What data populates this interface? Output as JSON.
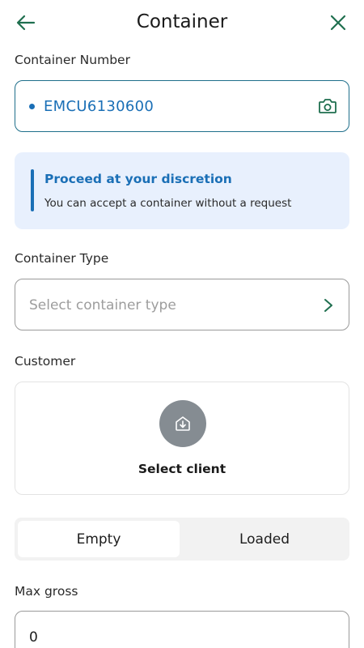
{
  "header": {
    "title": "Container",
    "back_icon": "arrow-left-icon",
    "close_icon": "close-icon",
    "accent_color": "#1f6f4f"
  },
  "container_number": {
    "label": "Container Number",
    "value": "EMCU6130600",
    "camera_icon": "camera-icon"
  },
  "notice": {
    "title": "Proceed at your discretion",
    "text": "You can accept a container without a request"
  },
  "container_type": {
    "label": "Container Type",
    "placeholder": "Select container type"
  },
  "customer": {
    "label": "Customer",
    "select_label": "Select client",
    "icon": "house-download-icon"
  },
  "load_toggle": {
    "options": [
      "Empty",
      "Loaded"
    ],
    "selected": "Empty"
  },
  "max_gross": {
    "label": "Max gross",
    "value": "0"
  }
}
